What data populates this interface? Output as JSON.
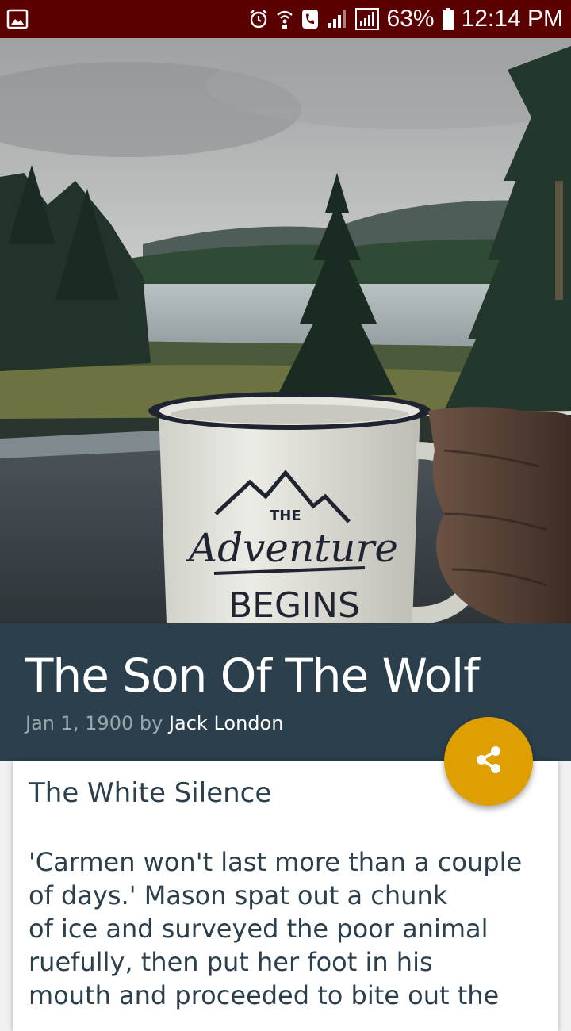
{
  "status_bar": {
    "battery": "63%",
    "time": "12:14 PM",
    "icons": [
      "image-icon",
      "alarm-icon",
      "wifi-call-icon",
      "call-icon",
      "signal-icon",
      "signal-box-icon",
      "battery-icon"
    ]
  },
  "hero": {
    "mug_text_top": "THE",
    "mug_text_script": "Adventure",
    "mug_text_bottom": "BEGINS"
  },
  "article": {
    "title": "The Son Of The Wolf",
    "date": "Jan 1, 1900",
    "by": "by",
    "author": "Jack London",
    "chapter": "The White Silence",
    "lines": [
      "'Carmen won't last more than a couple",
      "of days.' Mason spat out a chunk",
      "of ice and surveyed the poor animal",
      "ruefully, then put her foot in his",
      "mouth and proceeded to bite out the"
    ]
  },
  "fab": {
    "icon": "share-icon"
  },
  "colors": {
    "status_bar": "#5a0000",
    "title_band": "#2b3f4c",
    "fab": "#e09f00",
    "text": "#2b3f4c"
  }
}
